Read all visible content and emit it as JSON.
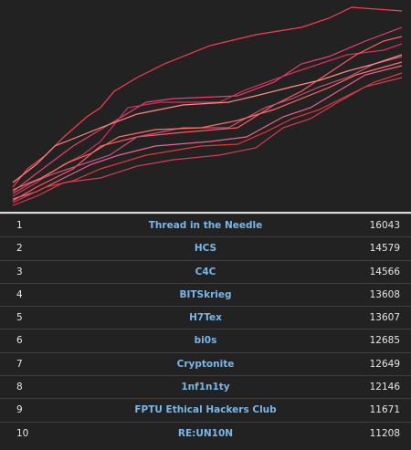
{
  "graph": {
    "line_colors": [
      "#ff3b4f",
      "#e83f6f",
      "#d8315b",
      "#ff5a5f",
      "#c94f7c",
      "#f06292",
      "#e53935",
      "#ff6f61",
      "#d63b57",
      "#ff8a80"
    ]
  },
  "scoreboard": {
    "rows": [
      {
        "rank": "1",
        "team": "Thread in the Needle",
        "score": "16043"
      },
      {
        "rank": "2",
        "team": "HCS",
        "score": "14579"
      },
      {
        "rank": "3",
        "team": "C4C",
        "score": "14566"
      },
      {
        "rank": "4",
        "team": "BITSkrieg",
        "score": "13608"
      },
      {
        "rank": "5",
        "team": "H7Tex",
        "score": "13607"
      },
      {
        "rank": "6",
        "team": "bi0s",
        "score": "12685"
      },
      {
        "rank": "7",
        "team": "Cryptonite",
        "score": "12649"
      },
      {
        "rank": "8",
        "team": "1nf1n1ty",
        "score": "12146"
      },
      {
        "rank": "9",
        "team": "FPTU Ethical Hackers Club",
        "score": "11671"
      },
      {
        "rank": "10",
        "team": "RE:UN10N",
        "score": "11208"
      }
    ]
  }
}
